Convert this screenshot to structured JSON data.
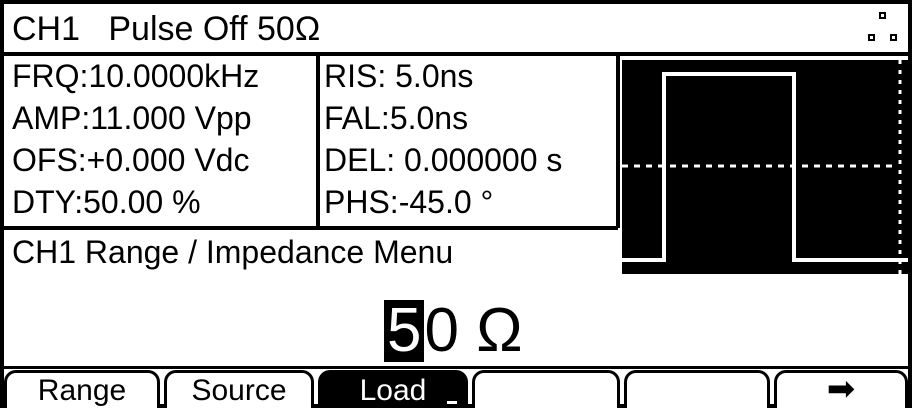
{
  "header": {
    "title": "CH1   Pulse Off 50Ω"
  },
  "params_left": [
    {
      "label": "FRQ:",
      "value": "10.0000kHz"
    },
    {
      "label": "AMP:",
      "value": "11.000 Vpp"
    },
    {
      "label": "OFS:",
      "value": "+0.000 Vdc"
    },
    {
      "label": "DTY:",
      "value": "50.00 %"
    }
  ],
  "params_right": [
    {
      "label": "RIS:",
      "value": " 5.0ns"
    },
    {
      "label": "FAL:",
      "value": "5.0ns"
    },
    {
      "label": "DEL:",
      "value": " 0.000000 s"
    },
    {
      "label": "PHS:",
      "value": "-45.0 °"
    }
  ],
  "menu": {
    "title": "CH1 Range / Impedance Menu"
  },
  "impedance": {
    "cursor_digit": "5",
    "rest": "0 Ω"
  },
  "softkeys": [
    {
      "label": "Range",
      "active": false
    },
    {
      "label": "Source",
      "active": false
    },
    {
      "label": "Load",
      "active": true
    },
    {
      "label": "",
      "active": false
    },
    {
      "label": "",
      "active": false
    },
    {
      "label": "➡",
      "active": false
    }
  ],
  "waveform": {
    "type": "pulse",
    "duty_cycle_percent": 50,
    "colors": {
      "background": "#000000",
      "trace": "#ffffff"
    }
  },
  "icons": {
    "ports": "connector-ports-icon",
    "next": "right-arrow-icon"
  }
}
